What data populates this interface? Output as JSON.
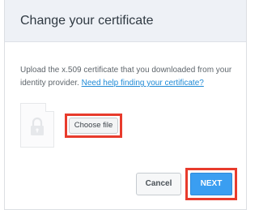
{
  "dialog": {
    "title": "Change your certificate",
    "description": "Upload the x.509 certificate that you downloaded from your identity provider.",
    "help_link": "Need help finding your certificate?",
    "file": {
      "icon": "lock-icon",
      "choose_label": "Choose file"
    },
    "actions": {
      "cancel_label": "Cancel",
      "next_label": "NEXT"
    }
  },
  "colors": {
    "header_bg": "#eef1f6",
    "link": "#1f8ad6",
    "primary": "#3a9ef1",
    "highlight": "#e83b2c"
  }
}
